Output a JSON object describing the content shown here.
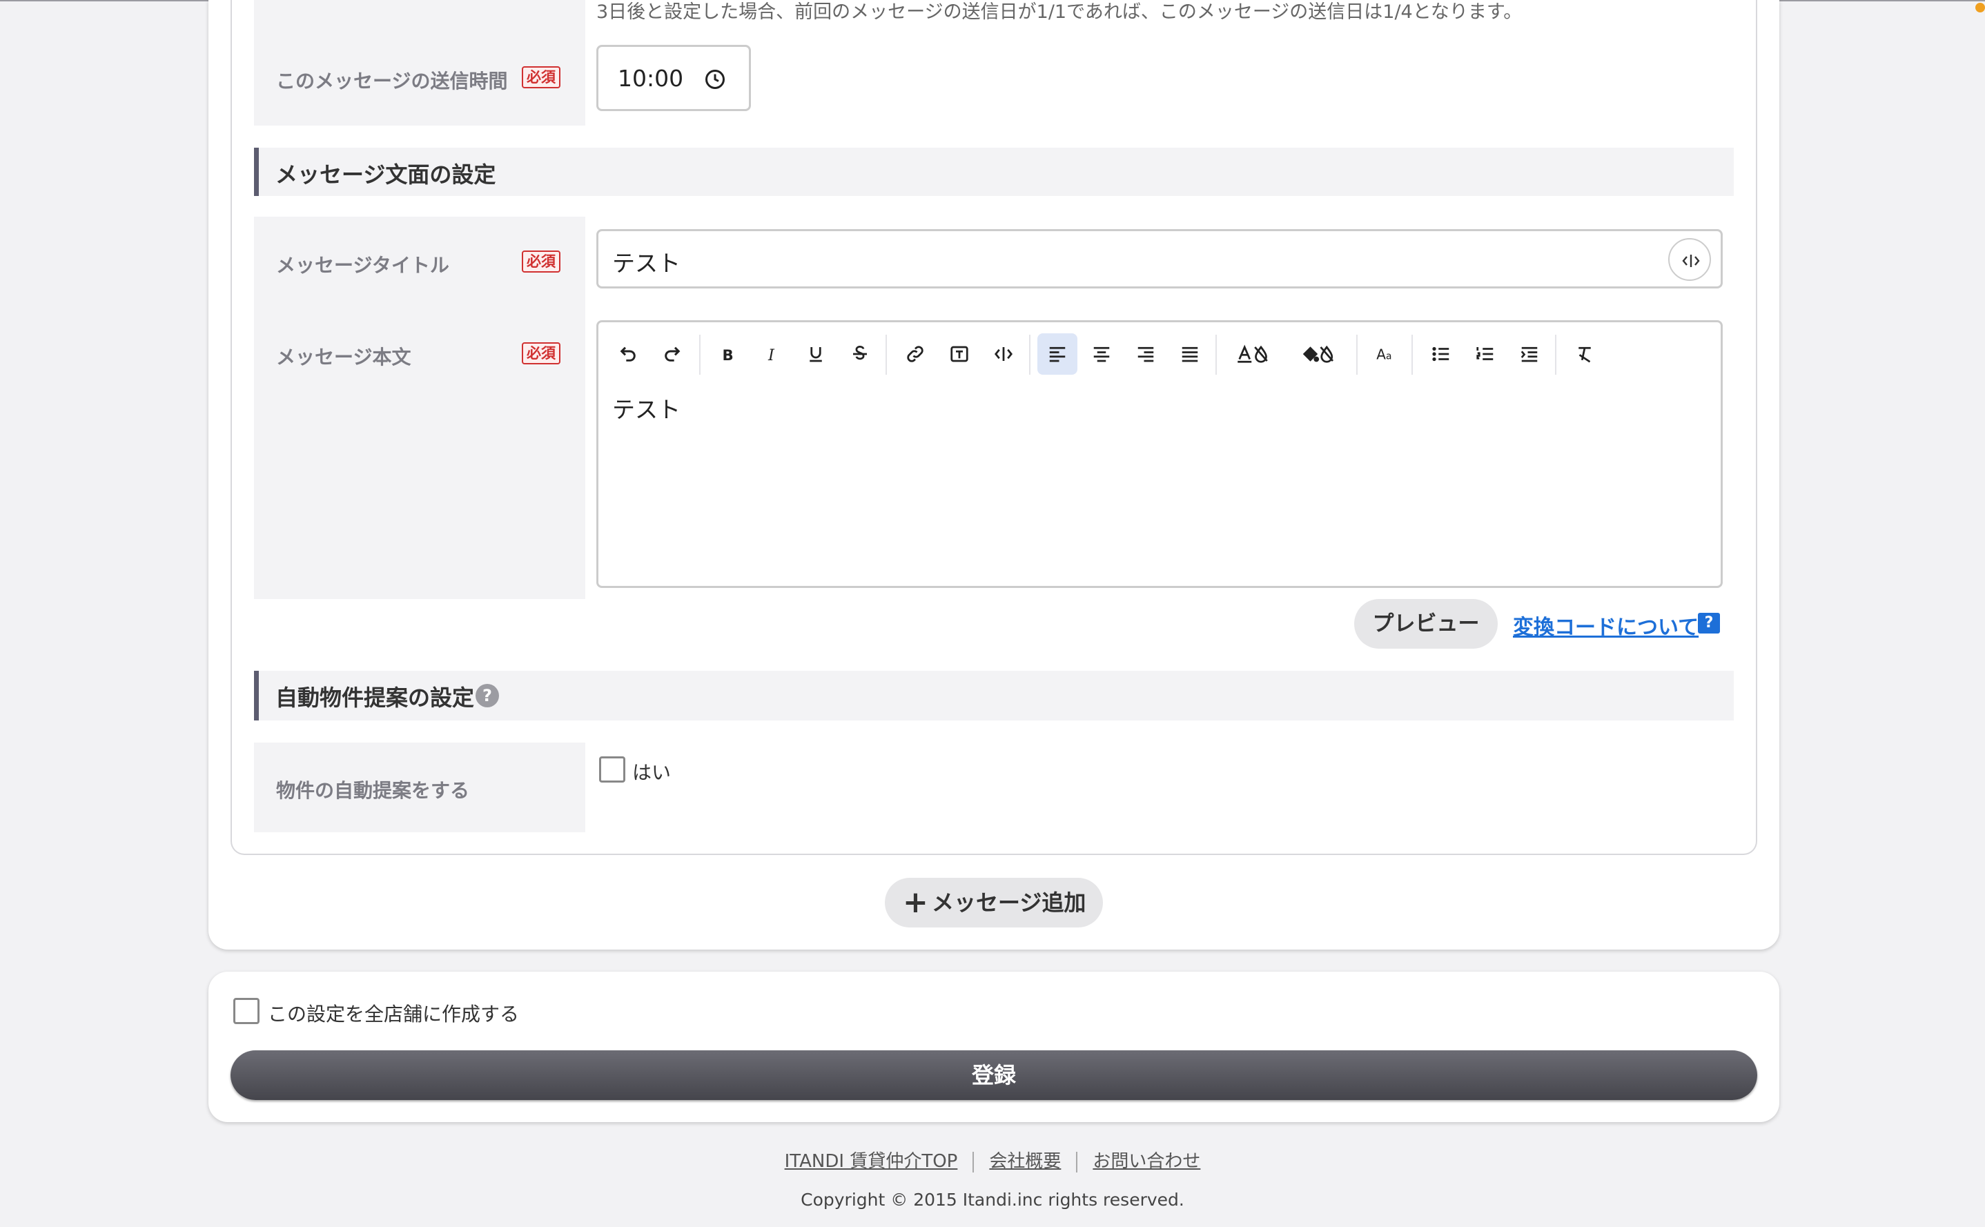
{
  "schedule": {
    "note": "3日後と設定した場合、前回のメッセージの送信日が1/1であれば、このメッセージの送信日は1/4となります。",
    "send_time_label": "このメッセージの送信時間",
    "send_time_value": "10:00"
  },
  "required_badge": "必須",
  "message_section": {
    "title": "メッセージ文面の設定",
    "title_label": "メッセージタイトル",
    "title_value": "テスト",
    "body_label": "メッセージ本文",
    "body_value": "テスト",
    "preview_label": "プレビュー",
    "help_link": "変換コードについて",
    "help_icon": "?"
  },
  "toolbar": [
    "undo-icon",
    "redo-icon",
    "bold-icon",
    "italic-icon",
    "underline-icon",
    "strikethrough-icon",
    "link-icon",
    "textbox-icon",
    "code-icon",
    "align-left-icon",
    "align-center-icon",
    "align-right-icon",
    "align-justify-icon",
    "font-color-icon",
    "background-color-icon",
    "font-size-icon",
    "bullet-list-icon",
    "numbered-list-icon",
    "indent-icon",
    "clear-format-icon"
  ],
  "auto_suggest": {
    "title": "自動物件提案の設定",
    "help_icon": "?",
    "label": "物件の自動提案をする",
    "checkbox_label": "はい"
  },
  "add_message_label": "メッセージ追加",
  "add_icon": "+",
  "all_stores_label": "この設定を全店舗に作成する",
  "submit_label": "登録",
  "footer": {
    "links": [
      "ITANDI 賃貸仲介TOP",
      "会社概要",
      "お問い合わせ"
    ],
    "copyright": "Copyright © 2015 Itandi.inc rights reserved."
  },
  "colors": {
    "accent_blue": "#1d6fd8",
    "required_red": "#d03030",
    "section_bar": "#5c5c70"
  }
}
